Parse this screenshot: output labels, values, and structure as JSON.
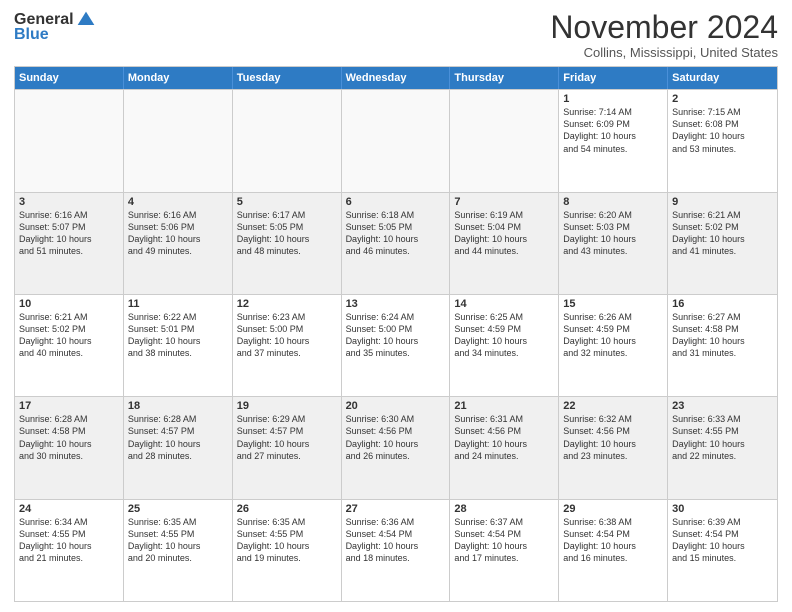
{
  "logo": {
    "general": "General",
    "blue": "Blue"
  },
  "title": "November 2024",
  "location": "Collins, Mississippi, United States",
  "days": [
    "Sunday",
    "Monday",
    "Tuesday",
    "Wednesday",
    "Thursday",
    "Friday",
    "Saturday"
  ],
  "weeks": [
    [
      {
        "day": "",
        "info": ""
      },
      {
        "day": "",
        "info": ""
      },
      {
        "day": "",
        "info": ""
      },
      {
        "day": "",
        "info": ""
      },
      {
        "day": "",
        "info": ""
      },
      {
        "day": "1",
        "info": "Sunrise: 7:14 AM\nSunset: 6:09 PM\nDaylight: 10 hours\nand 54 minutes."
      },
      {
        "day": "2",
        "info": "Sunrise: 7:15 AM\nSunset: 6:08 PM\nDaylight: 10 hours\nand 53 minutes."
      }
    ],
    [
      {
        "day": "3",
        "info": "Sunrise: 6:16 AM\nSunset: 5:07 PM\nDaylight: 10 hours\nand 51 minutes."
      },
      {
        "day": "4",
        "info": "Sunrise: 6:16 AM\nSunset: 5:06 PM\nDaylight: 10 hours\nand 49 minutes."
      },
      {
        "day": "5",
        "info": "Sunrise: 6:17 AM\nSunset: 5:05 PM\nDaylight: 10 hours\nand 48 minutes."
      },
      {
        "day": "6",
        "info": "Sunrise: 6:18 AM\nSunset: 5:05 PM\nDaylight: 10 hours\nand 46 minutes."
      },
      {
        "day": "7",
        "info": "Sunrise: 6:19 AM\nSunset: 5:04 PM\nDaylight: 10 hours\nand 44 minutes."
      },
      {
        "day": "8",
        "info": "Sunrise: 6:20 AM\nSunset: 5:03 PM\nDaylight: 10 hours\nand 43 minutes."
      },
      {
        "day": "9",
        "info": "Sunrise: 6:21 AM\nSunset: 5:02 PM\nDaylight: 10 hours\nand 41 minutes."
      }
    ],
    [
      {
        "day": "10",
        "info": "Sunrise: 6:21 AM\nSunset: 5:02 PM\nDaylight: 10 hours\nand 40 minutes."
      },
      {
        "day": "11",
        "info": "Sunrise: 6:22 AM\nSunset: 5:01 PM\nDaylight: 10 hours\nand 38 minutes."
      },
      {
        "day": "12",
        "info": "Sunrise: 6:23 AM\nSunset: 5:00 PM\nDaylight: 10 hours\nand 37 minutes."
      },
      {
        "day": "13",
        "info": "Sunrise: 6:24 AM\nSunset: 5:00 PM\nDaylight: 10 hours\nand 35 minutes."
      },
      {
        "day": "14",
        "info": "Sunrise: 6:25 AM\nSunset: 4:59 PM\nDaylight: 10 hours\nand 34 minutes."
      },
      {
        "day": "15",
        "info": "Sunrise: 6:26 AM\nSunset: 4:59 PM\nDaylight: 10 hours\nand 32 minutes."
      },
      {
        "day": "16",
        "info": "Sunrise: 6:27 AM\nSunset: 4:58 PM\nDaylight: 10 hours\nand 31 minutes."
      }
    ],
    [
      {
        "day": "17",
        "info": "Sunrise: 6:28 AM\nSunset: 4:58 PM\nDaylight: 10 hours\nand 30 minutes."
      },
      {
        "day": "18",
        "info": "Sunrise: 6:28 AM\nSunset: 4:57 PM\nDaylight: 10 hours\nand 28 minutes."
      },
      {
        "day": "19",
        "info": "Sunrise: 6:29 AM\nSunset: 4:57 PM\nDaylight: 10 hours\nand 27 minutes."
      },
      {
        "day": "20",
        "info": "Sunrise: 6:30 AM\nSunset: 4:56 PM\nDaylight: 10 hours\nand 26 minutes."
      },
      {
        "day": "21",
        "info": "Sunrise: 6:31 AM\nSunset: 4:56 PM\nDaylight: 10 hours\nand 24 minutes."
      },
      {
        "day": "22",
        "info": "Sunrise: 6:32 AM\nSunset: 4:56 PM\nDaylight: 10 hours\nand 23 minutes."
      },
      {
        "day": "23",
        "info": "Sunrise: 6:33 AM\nSunset: 4:55 PM\nDaylight: 10 hours\nand 22 minutes."
      }
    ],
    [
      {
        "day": "24",
        "info": "Sunrise: 6:34 AM\nSunset: 4:55 PM\nDaylight: 10 hours\nand 21 minutes."
      },
      {
        "day": "25",
        "info": "Sunrise: 6:35 AM\nSunset: 4:55 PM\nDaylight: 10 hours\nand 20 minutes."
      },
      {
        "day": "26",
        "info": "Sunrise: 6:35 AM\nSunset: 4:55 PM\nDaylight: 10 hours\nand 19 minutes."
      },
      {
        "day": "27",
        "info": "Sunrise: 6:36 AM\nSunset: 4:54 PM\nDaylight: 10 hours\nand 18 minutes."
      },
      {
        "day": "28",
        "info": "Sunrise: 6:37 AM\nSunset: 4:54 PM\nDaylight: 10 hours\nand 17 minutes."
      },
      {
        "day": "29",
        "info": "Sunrise: 6:38 AM\nSunset: 4:54 PM\nDaylight: 10 hours\nand 16 minutes."
      },
      {
        "day": "30",
        "info": "Sunrise: 6:39 AM\nSunset: 4:54 PM\nDaylight: 10 hours\nand 15 minutes."
      }
    ]
  ]
}
